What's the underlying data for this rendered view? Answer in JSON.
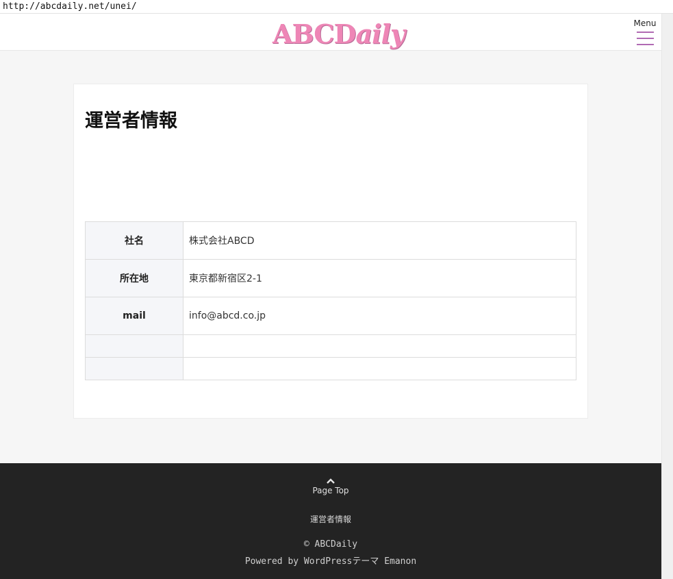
{
  "browser": {
    "url": "http://abcdaily.net/unei/"
  },
  "header": {
    "logo_text_plain": "ABCD",
    "logo_text_italic": "aily",
    "menu_label": "Menu",
    "menu_icon": "hamburger-icon",
    "accent_color": "#b06ab3",
    "logo_color": "#ee86b6"
  },
  "main": {
    "title": "運営者情報",
    "table": {
      "rows": [
        {
          "label": "社名",
          "value": "株式会社ABCD"
        },
        {
          "label": "所在地",
          "value": "東京都新宿区2-1"
        },
        {
          "label": "mail",
          "value": "info@abcd.co.jp"
        },
        {
          "label": "",
          "value": ""
        },
        {
          "label": "",
          "value": ""
        }
      ]
    }
  },
  "footer": {
    "page_top_icon": "chevron-up-icon",
    "page_top_label": "Page Top",
    "link": "運営者情報",
    "copyright": "© ABCDaily",
    "powered": "Powered by WordPressテーマ Emanon",
    "background": "#232323"
  }
}
